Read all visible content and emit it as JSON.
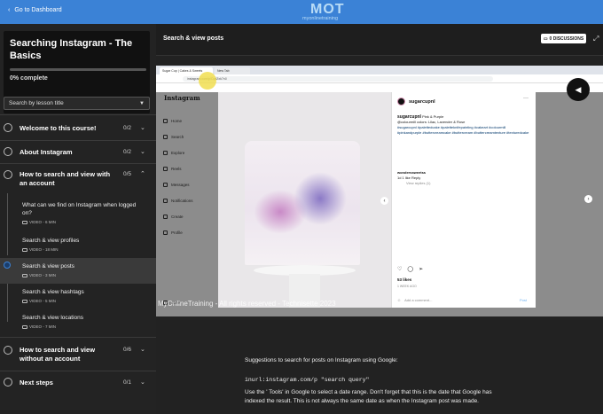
{
  "topbar": {
    "back_label": "Go to Dashboard",
    "logo_text": "MOT",
    "logo_sub": "myonlinetraining"
  },
  "course": {
    "title": "Searching Instagram - The Basics",
    "progress_label": "0% complete",
    "progress_value": 0.0
  },
  "search": {
    "label": "Search by lesson title"
  },
  "sections": [
    {
      "title": "Welcome to this course!",
      "count": "0/2"
    },
    {
      "title": "About Instagram",
      "count": "0/2"
    },
    {
      "title": "How to search and view with an account",
      "count": "0/5",
      "expanded": true
    },
    {
      "title": "How to search and view without an account",
      "count": "0/6"
    },
    {
      "title": "Next steps",
      "count": "0/1"
    }
  ],
  "lessons": [
    {
      "title": "What can we find on Instagram when logged on?",
      "meta": "VIDEO - 6 MIN"
    },
    {
      "title": "Search & view profiles",
      "meta": "VIDEO - 18 MIN"
    },
    {
      "title": "Search & view posts",
      "meta": "VIDEO - 3 MIN",
      "active": true
    },
    {
      "title": "Search & view hashtags",
      "meta": "VIDEO - 5 MIN"
    },
    {
      "title": "Search & view locations",
      "meta": "VIDEO - 7 MIN"
    }
  ],
  "header": {
    "lesson_title": "Search & view posts",
    "discussions_label": "0 DISCUSSIONS"
  },
  "video": {
    "tab1": "Sugar Cup | Cakes & Sweets",
    "tab2": "New Tab",
    "url": "instagram.com/p/CqdZxk7r4/",
    "ig_logo": "Instagram",
    "nav": [
      "Home",
      "Search",
      "Explore",
      "Reels",
      "Messages",
      "Notifications",
      "Create",
      "Profile",
      "More"
    ],
    "username": "sugarcupnl",
    "caption_head": "Pink & Purple",
    "caption_line1": "@colourmill colors: Lilac, Lavender & Rose",
    "hashtags": "#sugarcupnl #palettedcake #paletteknifepainting #cakeart #colourmill #pinkandpurple #buttercreamcake #buttercream #buttercreamtexture #texturedcake",
    "comment_user": "wonderssweetss",
    "comment_meta": "1d   1 like   Reply",
    "comment_replies": "View replies (1)",
    "likes": "53 likes",
    "date": "1 WEEK AGO",
    "add_comment": "Add a comment...",
    "post_label": "Post",
    "watermark": "MyOnlineTraining - All rights reserved - Technisette 2023"
  },
  "description": {
    "intro": "Suggestions to search for posts on Instagram using Google:",
    "code": "inurl:instagram.com/p \"search query\"",
    "body": "Use the ' Tools' in Google to select a date range. Don't forget that this is the date that Google has indexed the result. This is not always the same date as when the Instagram post was made."
  },
  "colors": {
    "accent": "#3b82d6",
    "topbar": "#3b82d6",
    "sidebar": "#232323",
    "active_lesson": "#3a3a3a"
  }
}
